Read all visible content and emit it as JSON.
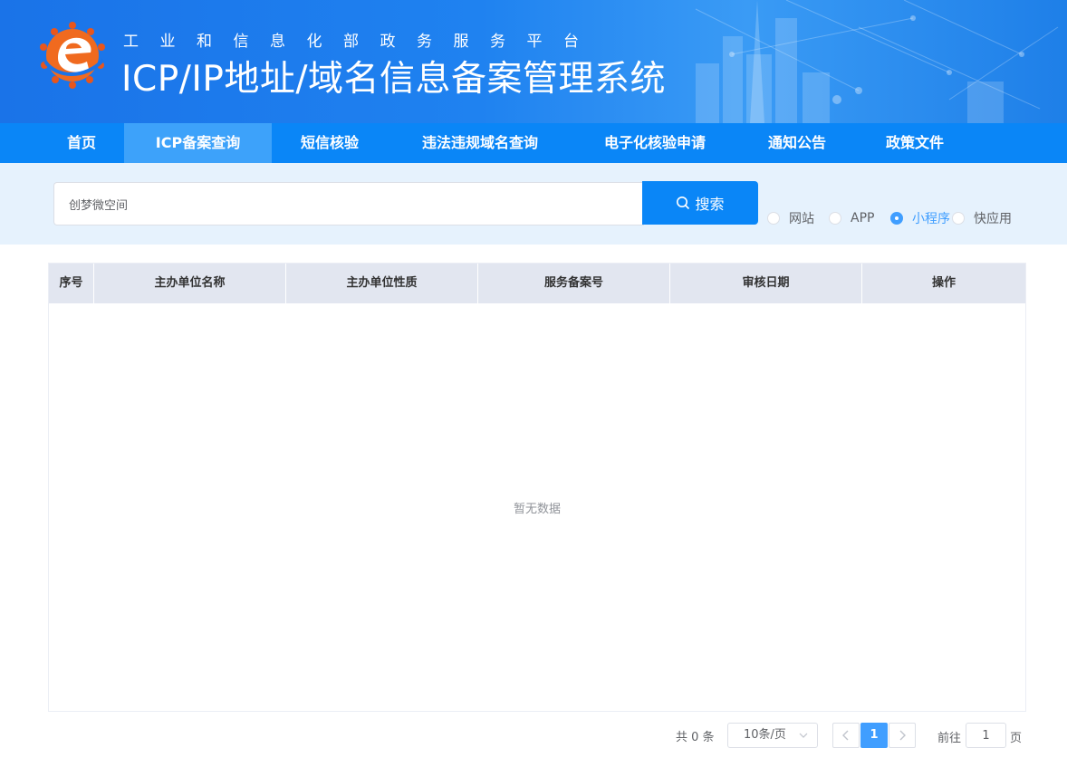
{
  "header": {
    "subtitle": "工业和信息化部政务服务平台",
    "title": "ICP/IP地址/域名信息备案管理系统"
  },
  "nav": {
    "items": [
      {
        "label": "首页"
      },
      {
        "label": "ICP备案查询"
      },
      {
        "label": "短信核验"
      },
      {
        "label": "违法违规域名查询"
      },
      {
        "label": "电子化核验申请"
      },
      {
        "label": "通知公告"
      },
      {
        "label": "政策文件"
      }
    ],
    "active_index": 1
  },
  "search": {
    "value": "创梦微空间",
    "button_label": "搜索",
    "types": [
      {
        "label": "网站",
        "checked": false
      },
      {
        "label": "APP",
        "checked": false
      },
      {
        "label": "小程序",
        "checked": true
      },
      {
        "label": "快应用",
        "checked": false
      }
    ]
  },
  "table": {
    "columns": [
      "序号",
      "主办单位名称",
      "主办单位性质",
      "服务备案号",
      "审核日期",
      "操作"
    ],
    "rows": [],
    "empty_text": "暂无数据"
  },
  "pagination": {
    "total_text": "共 0 条",
    "page_size": "10条/页",
    "current_page": "1",
    "goto_label": "前往",
    "goto_value": "1",
    "page_suffix": "页"
  },
  "colors": {
    "primary": "#0a86f7",
    "nav_active": "#3da2fa",
    "accent": "#409eff",
    "search_band": "#e6f2fd",
    "table_header": "#e2e6f0"
  }
}
